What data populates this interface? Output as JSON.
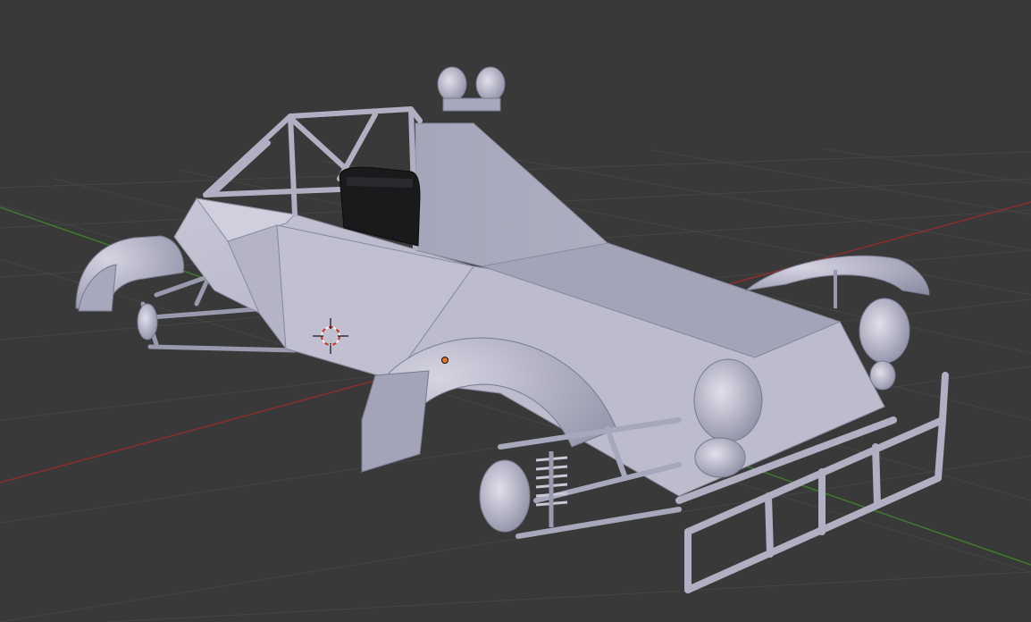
{
  "app": {
    "editor": "3D Viewport",
    "shading": "solid",
    "background_color": "#393939"
  },
  "scene": {
    "object": "offroad-buggy-model",
    "object_color": "#b4b4c6",
    "seat_color": "#1a1a1c",
    "grid_line_color": "#454545",
    "x_axis_color": "#8a2e2e",
    "y_axis_color": "#3f7a2e",
    "cursor_color": "#c83232",
    "origin_color": "#e07a1a",
    "visible_text": []
  }
}
